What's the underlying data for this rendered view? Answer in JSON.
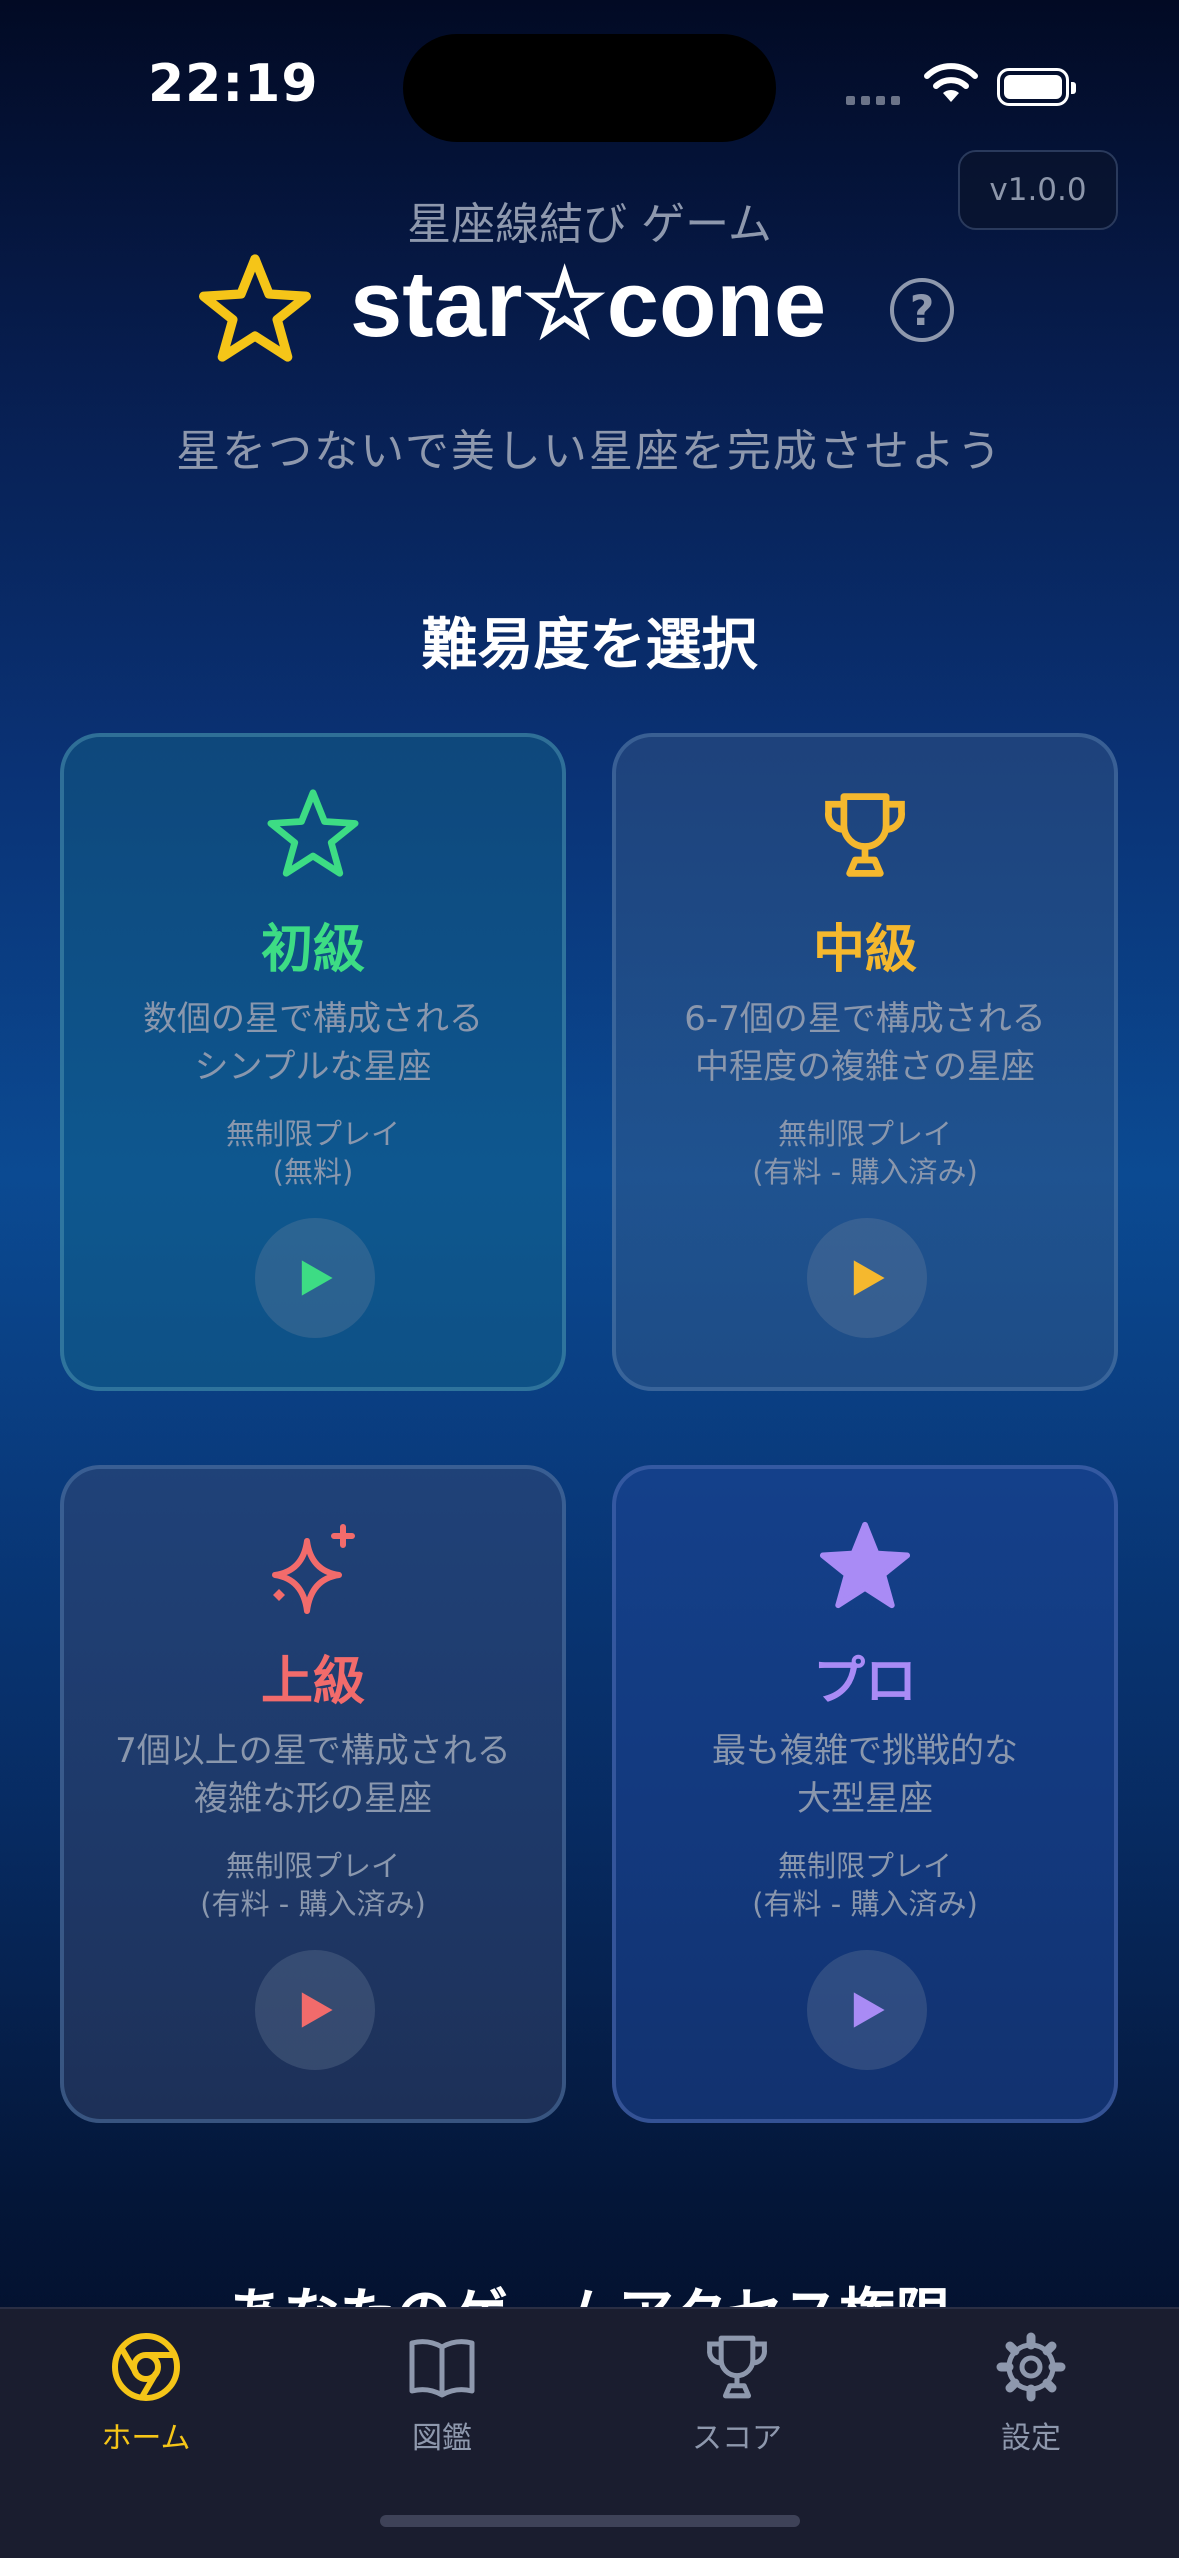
{
  "status_bar": {
    "time": "22:19"
  },
  "header": {
    "version": "v1.0.0",
    "subtitle": "星座線結び ゲーム",
    "app_title": "star☆cone",
    "tagline": "星をつないで美しい星座を完成させよう"
  },
  "main": {
    "section_title": "難易度を選択",
    "cards": [
      {
        "level": "初級",
        "desc_line1": "数個の星で構成される",
        "desc_line2": "シンプルな星座",
        "mode_line1": "無制限プレイ",
        "mode_line2": "(無料)",
        "icon": "star-outline-icon",
        "color": "#3ddc84"
      },
      {
        "level": "中級",
        "desc_line1": "6-7個の星で構成される",
        "desc_line2": "中程度の複雑さの星座",
        "mode_line1": "無制限プレイ",
        "mode_line2": "(有料 - 購入済み)",
        "icon": "trophy-icon",
        "color": "#f5b82e"
      },
      {
        "level": "上級",
        "desc_line1": "7個以上の星で構成される",
        "desc_line2": "複雑な形の星座",
        "mode_line1": "無制限プレイ",
        "mode_line2": "(有料 - 購入済み)",
        "icon": "sparkles-icon",
        "color": "#f26b6b"
      },
      {
        "level": "プロ",
        "desc_line1": "最も複雑で挑戦的な",
        "desc_line2": "大型星座",
        "mode_line1": "無制限プレイ",
        "mode_line2": "(有料 - 購入済み)",
        "icon": "star-filled-icon",
        "color": "#a98bf5"
      }
    ],
    "next_section_peek": "あなたのゲームアクセス権限"
  },
  "tabbar": {
    "active_color": "#f5c518",
    "items": [
      {
        "label": "ホーム",
        "icon": "home-chrome-icon"
      },
      {
        "label": "図鑑",
        "icon": "book-icon"
      },
      {
        "label": "スコア",
        "icon": "trophy-icon"
      },
      {
        "label": "設定",
        "icon": "gear-icon"
      }
    ]
  }
}
